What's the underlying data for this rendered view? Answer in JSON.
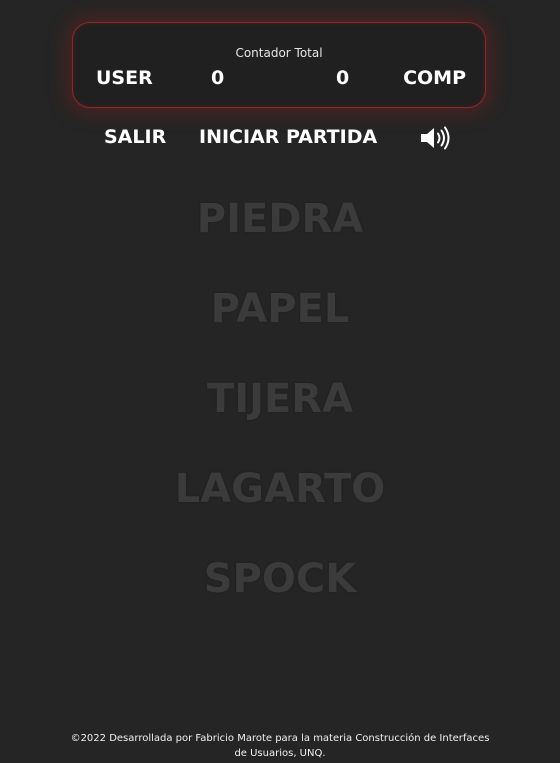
{
  "scoreboard": {
    "title": "Contador Total",
    "user_label": "USER",
    "user_score": "0",
    "comp_score": "0",
    "comp_label": "COMP"
  },
  "controls": {
    "salir": "SALIR",
    "iniciar": "INICIAR PARTIDA",
    "sound_icon": "speaker-volume-icon"
  },
  "choices": [
    {
      "label": "PIEDRA"
    },
    {
      "label": "PAPEL"
    },
    {
      "label": "TIJERA"
    },
    {
      "label": "LAGARTO"
    },
    {
      "label": "SPOCK"
    }
  ],
  "footer": {
    "text": "©2022 Desarrollada por Fabricio Marote para la materia Construcción de Interfaces de Usuarios, UNQ."
  },
  "colors": {
    "background": "#252525",
    "scoreboard_border": "#8a2a2a",
    "choice_text": "#3b3b3b",
    "text": "#ffffff"
  }
}
